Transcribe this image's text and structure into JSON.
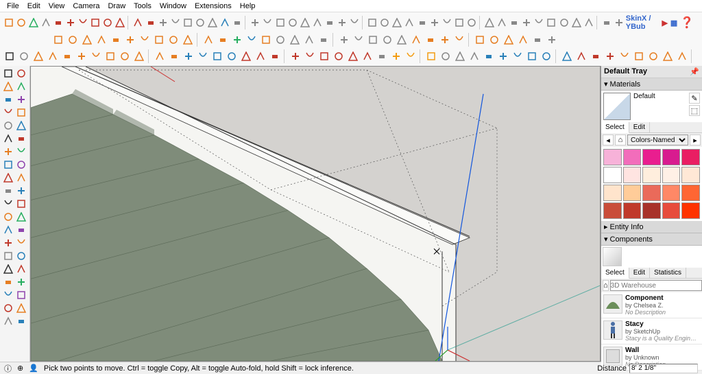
{
  "menu": [
    "File",
    "Edit",
    "View",
    "Camera",
    "Draw",
    "Tools",
    "Window",
    "Extensions",
    "Help"
  ],
  "brand": "SkinX / YBub",
  "toolbar_rows": [
    {
      "count": 48,
      "colors": [
        "#e67e22",
        "#e67e22",
        "#27ae60",
        "#888",
        "#c0392b",
        "#c0392b",
        "#c0392b",
        "#c0392b",
        "#c0392b",
        "#c0392b",
        "#c0392b",
        "#c0392b",
        "#888",
        "#888",
        "#888",
        "#888",
        "#888",
        "#2980b9",
        "#888",
        "#888",
        "#888",
        "#888",
        "#888",
        "#888",
        "#888",
        "#888",
        "#888",
        "#888",
        "#888",
        "#888",
        "#888",
        "#888",
        "#888",
        "#888",
        "#888",
        "#888",
        "#888",
        "#888",
        "#888",
        "#888",
        "#888",
        "#888",
        "#888",
        "#888",
        "#888",
        "#888",
        "#888",
        "#888"
      ]
    },
    {
      "count": 34,
      "prefix_gap": 70,
      "colors": [
        "#e67e22",
        "#e67e22",
        "#e67e22",
        "#e67e22",
        "#e67e22",
        "#e67e22",
        "#e67e22",
        "#e67e22",
        "#e67e22",
        "#e67e22",
        "#e67e22",
        "#e67e22",
        "#27ae60",
        "#2980b9",
        "#e67e22",
        "#888",
        "#888",
        "#888",
        "#888",
        "#888",
        "#888",
        "#888",
        "#888",
        "#888",
        "#e67e22",
        "#e67e22",
        "#e67e22",
        "#e67e22",
        "#e67e22",
        "#e67e22",
        "#e67e22",
        "#e67e22",
        "#888",
        "#888"
      ]
    },
    {
      "count": 46,
      "colors": [
        "#333",
        "#888",
        "#e67e22",
        "#e67e22",
        "#e67e22",
        "#e67e22",
        "#e67e22",
        "#e67e22",
        "#e67e22",
        "#e67e22",
        "#e67e22",
        "#e67e22",
        "#2980b9",
        "#2980b9",
        "#2980b9",
        "#2980b9",
        "#c0392b",
        "#c0392b",
        "#c0392b",
        "#c0392b",
        "#c0392b",
        "#c0392b",
        "#c0392b",
        "#c0392b",
        "#c0392b",
        "#888",
        "#f39c12",
        "#f39c12",
        "#f39c12",
        "#888",
        "#888",
        "#888",
        "#2980b9",
        "#2980b9",
        "#2980b9",
        "#2980b9",
        "#2980b9",
        "#2980b9",
        "#c0392b",
        "#c0392b",
        "#c0392b",
        "#e67e22",
        "#e67e22",
        "#e67e22",
        "#e67e22",
        "#e67e22"
      ]
    }
  ],
  "left_tool_rows": 20,
  "tray": {
    "title": "Default Tray",
    "materials": {
      "section": "Materials",
      "name": "Default",
      "tabs": [
        "Select",
        "Edit"
      ],
      "active_tab": 0,
      "library": "Colors-Named",
      "swatches": [
        "#f7b2d9",
        "#f26dbb",
        "#e91e8f",
        "#d81b8f",
        "#e91e63",
        "#ffffff",
        "#ffe4e1",
        "#ffeedd",
        "#fff0e6",
        "#ffe8d6",
        "#ffe4cc",
        "#ffcc99",
        "#ea6a5a",
        "#ff8866",
        "#ff6633",
        "#c94d3a",
        "#c0392b",
        "#a8322a",
        "#e74c3c",
        "#ff3300"
      ]
    },
    "entity_info_section": "Entity Info",
    "components": {
      "section": "Components",
      "tabs": [
        "Select",
        "Edit",
        "Statistics"
      ],
      "active_tab": 0,
      "search_placeholder": "3D Warehouse",
      "items": [
        {
          "name": "Component",
          "by": "Chelsea Z.",
          "desc": "No Description",
          "thumb_color": "#6b8e5a",
          "thumb_shape": "arch"
        },
        {
          "name": "Stacy",
          "by": "SketchUp",
          "desc": "Stacy is a Quality Engineer on the SketchUp core team and a native Co...",
          "thumb_color": "#4a6fa5",
          "thumb_shape": "person"
        },
        {
          "name": "Wall",
          "by": "Unknown",
          "desc": "No Description",
          "thumb_color": "#ddd",
          "thumb_shape": "box"
        }
      ]
    }
  },
  "status": {
    "hint": "Pick two points to move. Ctrl = toggle Copy, Alt = toggle Auto-fold, hold Shift = lock inference.",
    "distance_label": "Distance",
    "distance_value": "8' 2 1/8\""
  }
}
